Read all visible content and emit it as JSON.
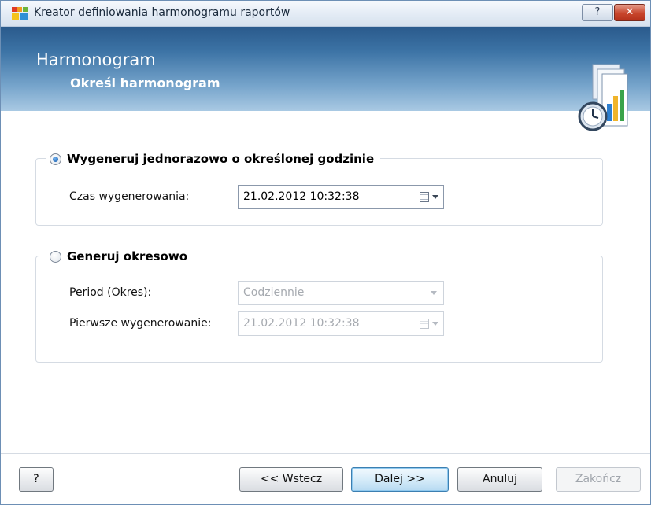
{
  "window": {
    "title": "Kreator definiowania harmonogramu raportów"
  },
  "titlebar": {
    "help_label": "?",
    "close_label": "✕"
  },
  "banner": {
    "title": "Harmonogram",
    "subtitle": "Określ harmonogram",
    "icon": "report-schedule-icon"
  },
  "once_group": {
    "legend": "Wygeneruj jednorazowo o określonej godzinie",
    "selected": true,
    "time_label": "Czas wygenerowania:",
    "time_value": "21.02.2012 10:32:38"
  },
  "periodic_group": {
    "legend": "Generuj okresowo",
    "selected": false,
    "period_label": "Period (Okres):",
    "period_value": "Codziennie",
    "first_label": "Pierwsze wygenerowanie:",
    "first_value": "21.02.2012 10:32:38"
  },
  "footer": {
    "help_label": "?",
    "back_label": "<< Wstecz",
    "next_label": "Dalej >>",
    "cancel_label": "Anuluj",
    "finish_label": "Zakończ"
  },
  "colors": {
    "banner_dark": "#2a5a8c",
    "banner_light": "#a9c9e3",
    "radio_selected": "#1459a8"
  }
}
